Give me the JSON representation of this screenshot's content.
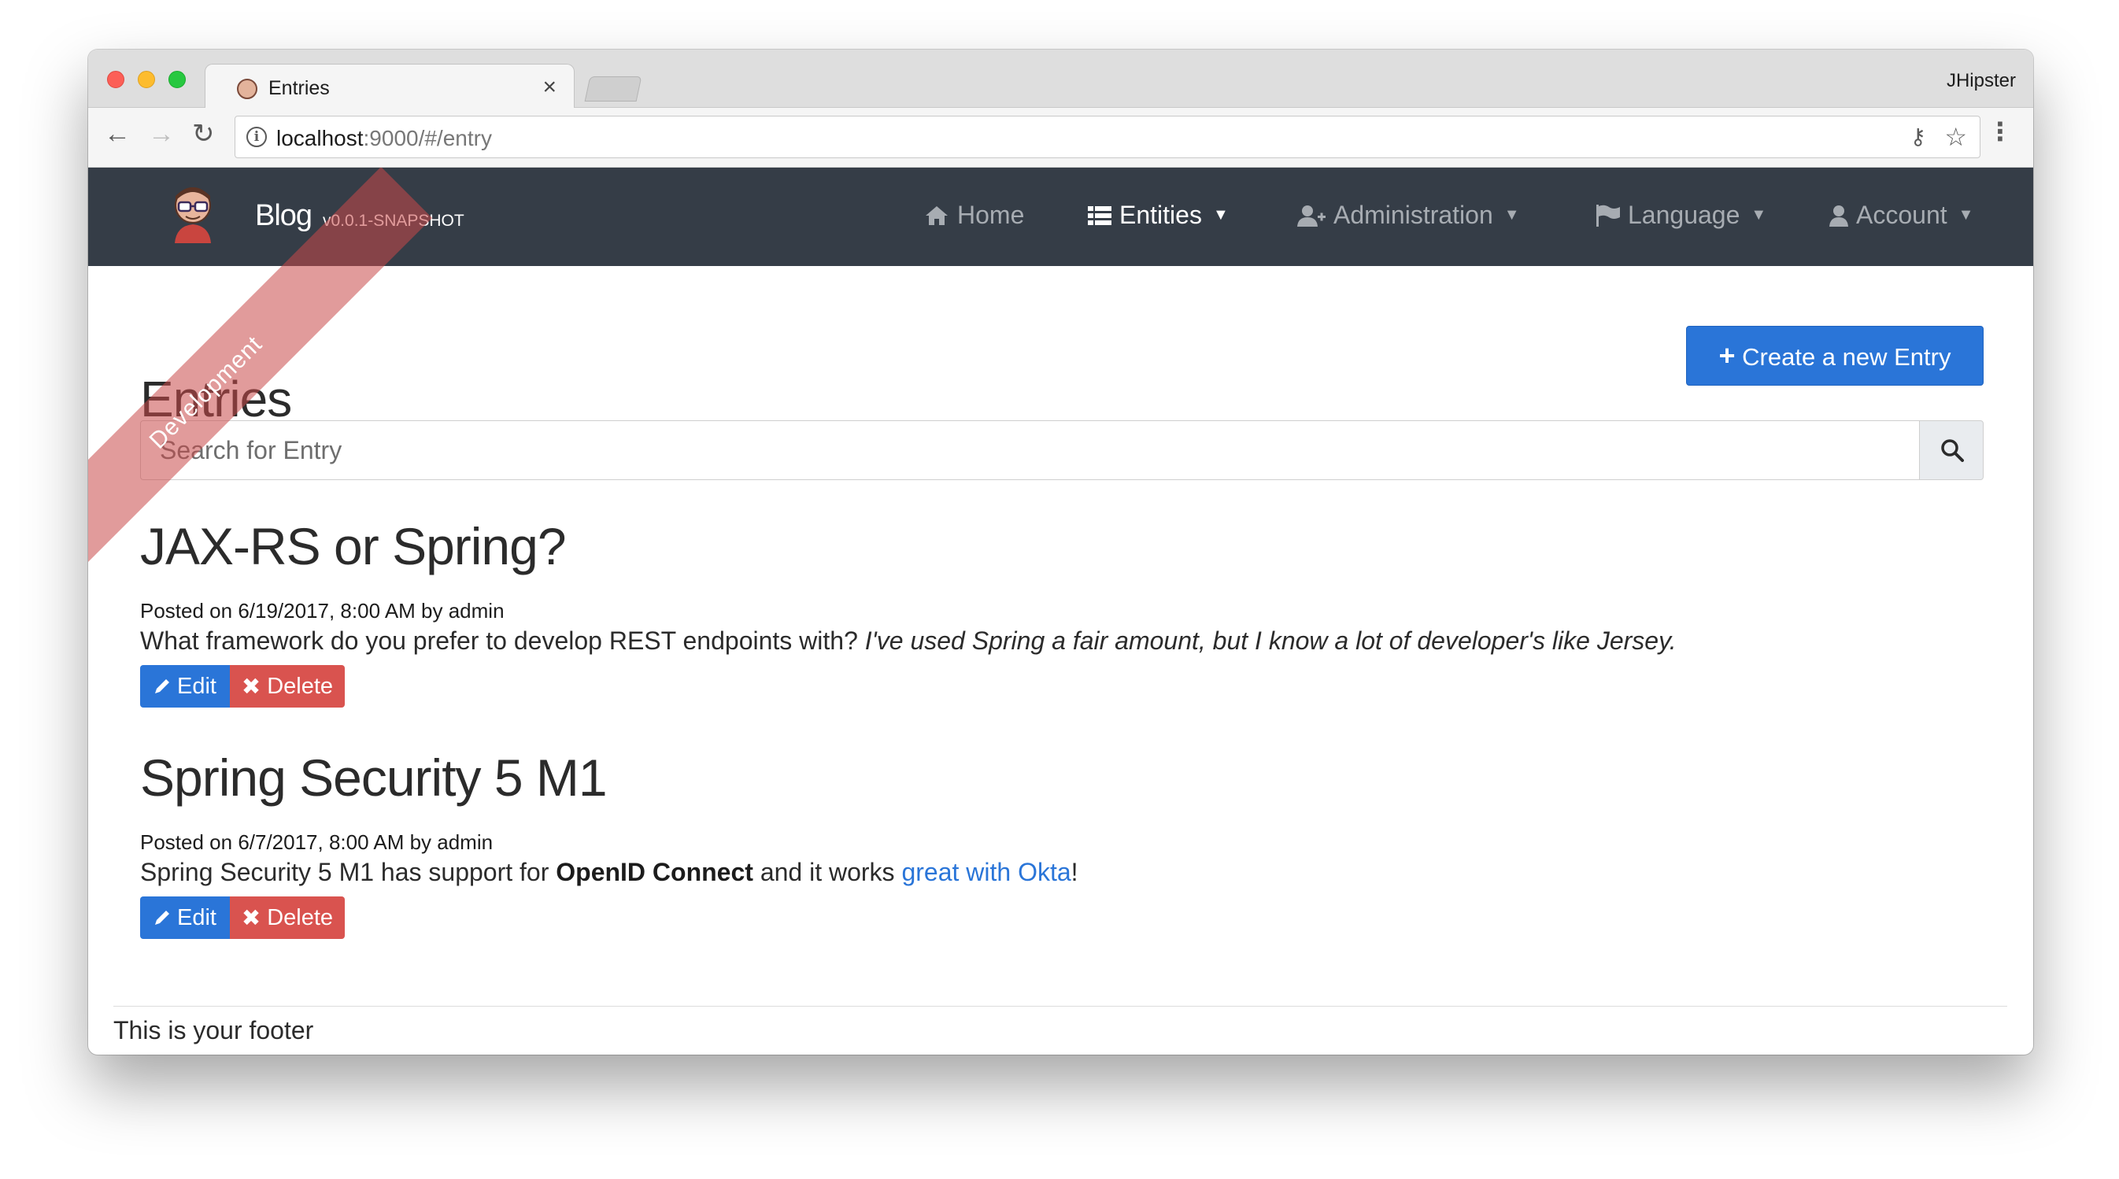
{
  "browser": {
    "tab_title": "Entries",
    "tab_close": "×",
    "profile_name": "JHipster",
    "url_host": "localhost",
    "url_path": ":9000/#/entry"
  },
  "navbar": {
    "brand_name": "Blog",
    "brand_version": "v0.0.1-SNAPSHOT",
    "ribbon_text": "Development",
    "items": [
      {
        "label": "Home",
        "icon": "home-icon"
      },
      {
        "label": "Entities",
        "icon": "list-icon",
        "active": true
      },
      {
        "label": "Administration",
        "icon": "user-plus-icon"
      },
      {
        "label": "Language",
        "icon": "flag-icon"
      },
      {
        "label": "Account",
        "icon": "user-icon"
      }
    ],
    "colors": {
      "background": "#353d47",
      "active": "#ffffff",
      "inactive": "#a7acb2"
    }
  },
  "page": {
    "title": "Entries",
    "create_button": "Create a new Entry",
    "search_placeholder": "Search for Entry"
  },
  "entries": [
    {
      "title": "JAX-RS or Spring?",
      "meta": "Posted on 6/19/2017, 8:00 AM by admin",
      "body_plain": "What framework do you prefer to develop REST endpoints with? ",
      "body_italic": "I've used Spring a fair amount, but I know a lot of developer's like Jersey."
    },
    {
      "title": "Spring Security 5 M1",
      "meta": "Posted on 6/7/2017, 8:00 AM by admin",
      "body_part1": "Spring Security 5 M1 has support for ",
      "body_bold": "OpenID Connect",
      "body_part2": " and it works ",
      "body_link": "great with Okta",
      "body_part3": "!"
    }
  ],
  "actions": {
    "edit": "Edit",
    "delete": "Delete"
  },
  "footer": {
    "text": "This is your footer"
  },
  "colors": {
    "primary": "#2a75d8",
    "danger": "#d9534f"
  }
}
